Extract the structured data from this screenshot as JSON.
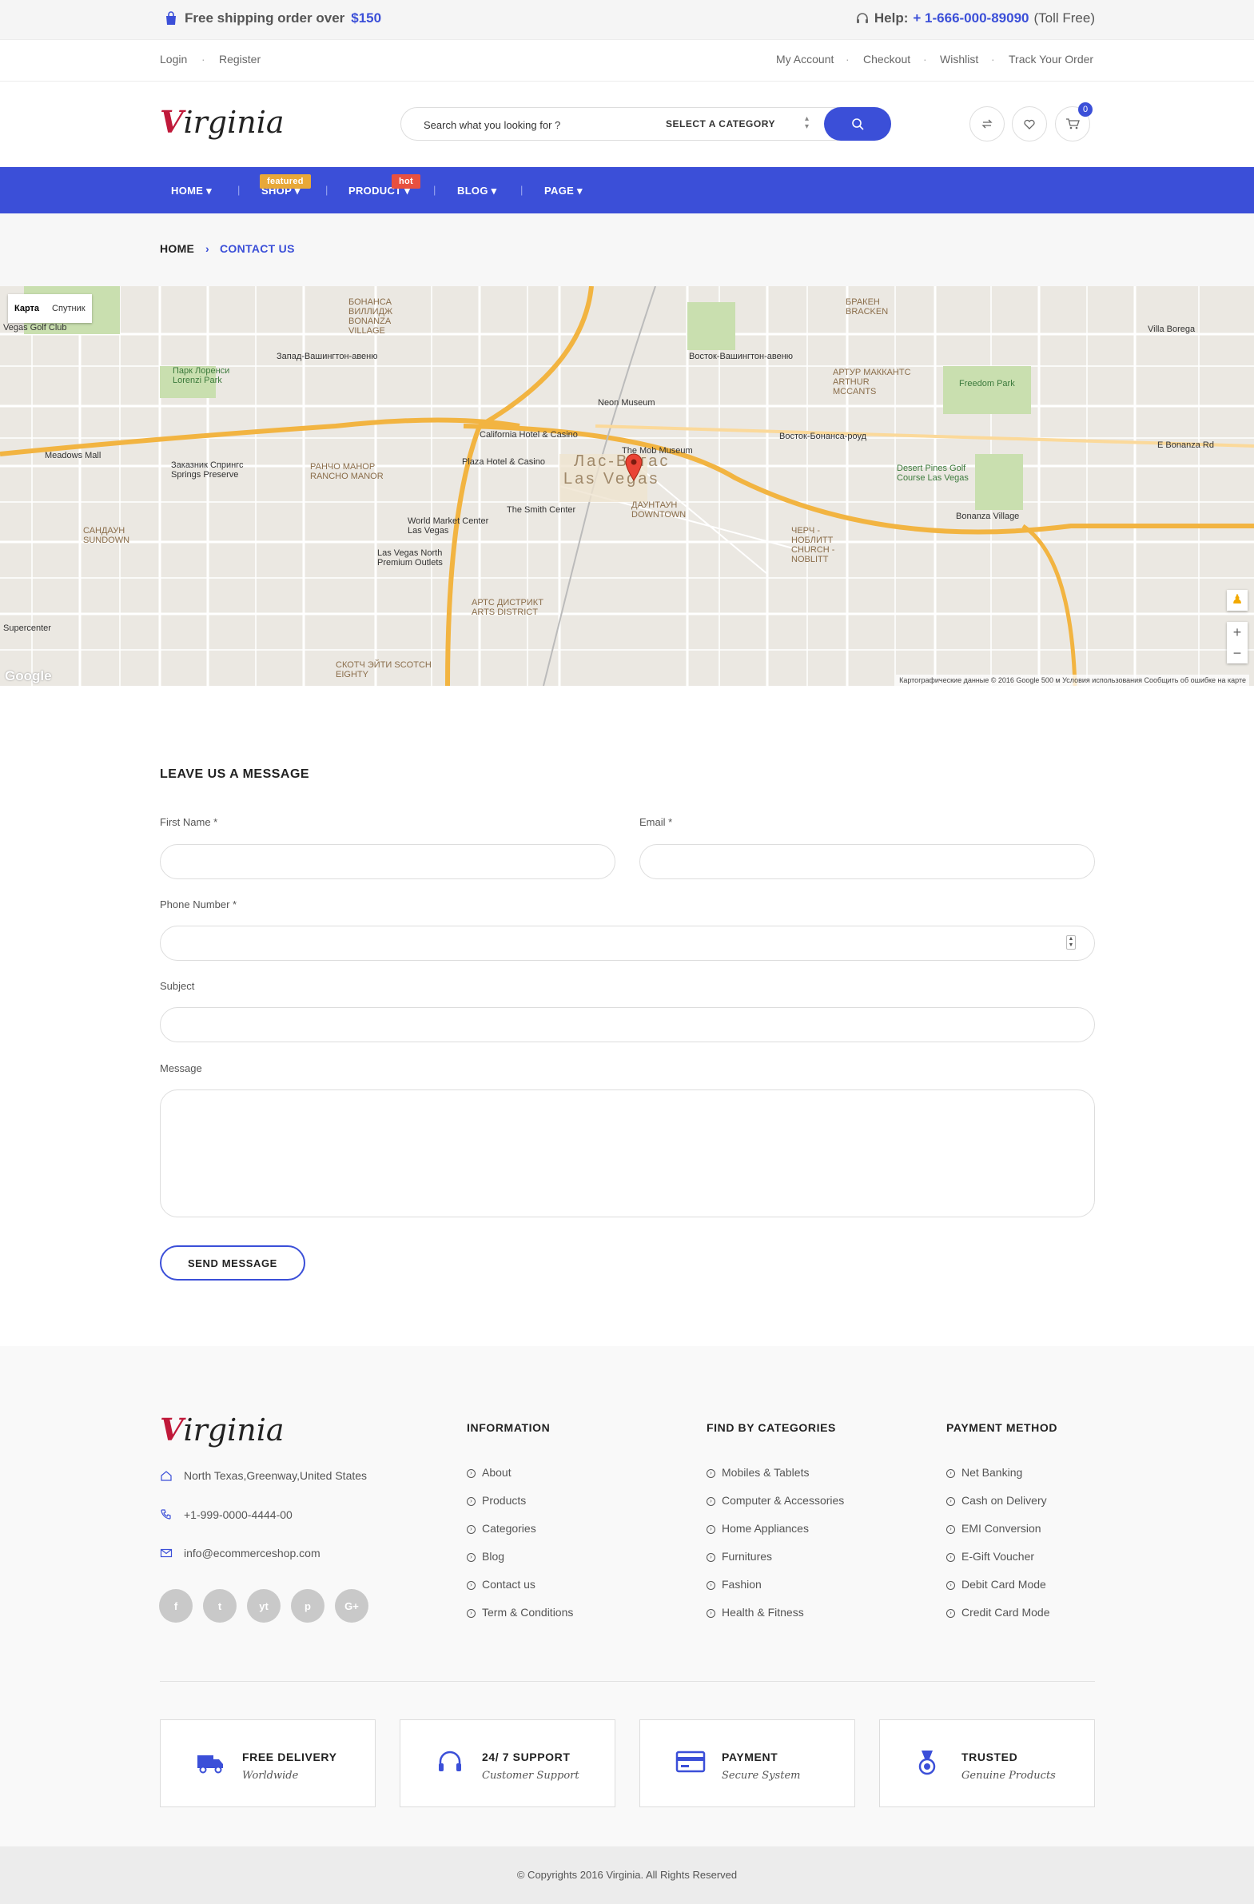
{
  "topbar": {
    "shipping_text": "Free shipping order over",
    "shipping_amount": "$150",
    "help_label": "Help:",
    "help_phone": "+ 1-666-000-89090",
    "help_note": "(Toll Free)"
  },
  "account_links": {
    "login": "Login",
    "register": "Register",
    "my_account": "My Account",
    "checkout": "Checkout",
    "wishlist": "Wishlist",
    "track_order": "Track Your Order"
  },
  "header": {
    "logo_first": "V",
    "logo_rest": "irginia",
    "search_placeholder": "Search what you looking for ?",
    "category_label": "SELECT A CATEGORY",
    "cart_count": "0"
  },
  "nav": {
    "items": [
      {
        "label": "HOME"
      },
      {
        "label": "SHOP",
        "tag": "featured"
      },
      {
        "label": "PRODUCT",
        "tag": "hot"
      },
      {
        "label": "BLOG"
      },
      {
        "label": "PAGE"
      }
    ]
  },
  "breadcrumb": {
    "home": "HOME",
    "current": "CONTACT US"
  },
  "map": {
    "toggle_map": "Карта",
    "toggle_satellite": "Спутник",
    "google": "Google",
    "attribution": "Картографические данные © 2016 Google   500 м   Условия использования   Сообщить об ошибке на карте",
    "labels": [
      "Las Vegas",
      "Лас-Вегас",
      "The Mob Museum",
      "Neon Museum",
      "California Hotel & Casino",
      "Plaza Hotel & Casino",
      "The Smith Center",
      "World Market Center Las Vegas",
      "Las Vegas North Premium Outlets",
      "Meadows Mall",
      "Заказник Спрингс Springs Preserve",
      "РАНЧО МАНОР RANCHO MANOR",
      "БОНАНСА ВИЛЛИДЖ BONANZA VILLAGE",
      "Парк Лоренси Lorenzi Park",
      "САНДАУН SUNDOWN",
      "АРТС ДИСТРИКТ ARTS DISTRICT",
      "СКОТЧ ЭЙТИ SCOTCH EIGHTY",
      "ДАУНТАУН DOWNTOWN",
      "ЧЕРЧ - НОБЛИТТ CHURCH - NOBLITT",
      "АРТУР МАККАНТС ARTHUR MCCANTS",
      "БРАКЕН BRACKEN",
      "Freedom Park",
      "Desert Pines Golf Course Las Vegas",
      "Bonanza Village",
      "Villa Borega",
      "Supercenter",
      "Vegas Golf Club",
      "E Bonanza Rd",
      "Восток-Бонанса-роуд",
      "Восток-Вашингтон-авеню",
      "Запад-Вашингтон-авеню"
    ]
  },
  "form": {
    "title": "LEAVE US A MESSAGE",
    "first_name_label": "First Name *",
    "email_label": "Email *",
    "phone_label": "Phone Number *",
    "subject_label": "Subject",
    "message_label": "Message",
    "submit_label": "SEND MESSAGE"
  },
  "footer": {
    "logo_first": "V",
    "logo_rest": "irginia",
    "address": "North Texas,Greenway,United States",
    "phone": "+1-999-0000-4444-00",
    "email": "info@ecommerceshop.com",
    "social": [
      "f",
      "t",
      "yt",
      "p",
      "G+"
    ],
    "columns": [
      {
        "title": "INFORMATION",
        "links": [
          "About",
          "Products",
          "Categories",
          "Blog",
          "Contact us",
          "Term & Conditions"
        ]
      },
      {
        "title": "FIND BY CATEGORIES",
        "links": [
          "Mobiles & Tablets",
          "Computer & Accessories",
          "Home Appliances",
          "Furnitures",
          "Fashion",
          "Health & Fitness"
        ]
      },
      {
        "title": "PAYMENT METHOD",
        "links": [
          "Net Banking",
          "Cash on Delivery",
          "EMI Conversion",
          "E-Gift Voucher",
          "Debit Card Mode",
          "Credit Card Mode"
        ]
      }
    ],
    "features": [
      {
        "title": "FREE DELIVERY",
        "sub": "Worldwide"
      },
      {
        "title": "24/ 7 SUPPORT",
        "sub": "Customer Support"
      },
      {
        "title": "PAYMENT",
        "sub": "Secure System"
      },
      {
        "title": "TRUSTED",
        "sub": "Genuine Products"
      }
    ],
    "copyright": "© Copyrights 2016 Virginia. All Rights Reserved"
  },
  "colors": {
    "accent": "#3b4fd8",
    "featured_tag": "#e8a838",
    "hot_tag": "#e8503f"
  }
}
